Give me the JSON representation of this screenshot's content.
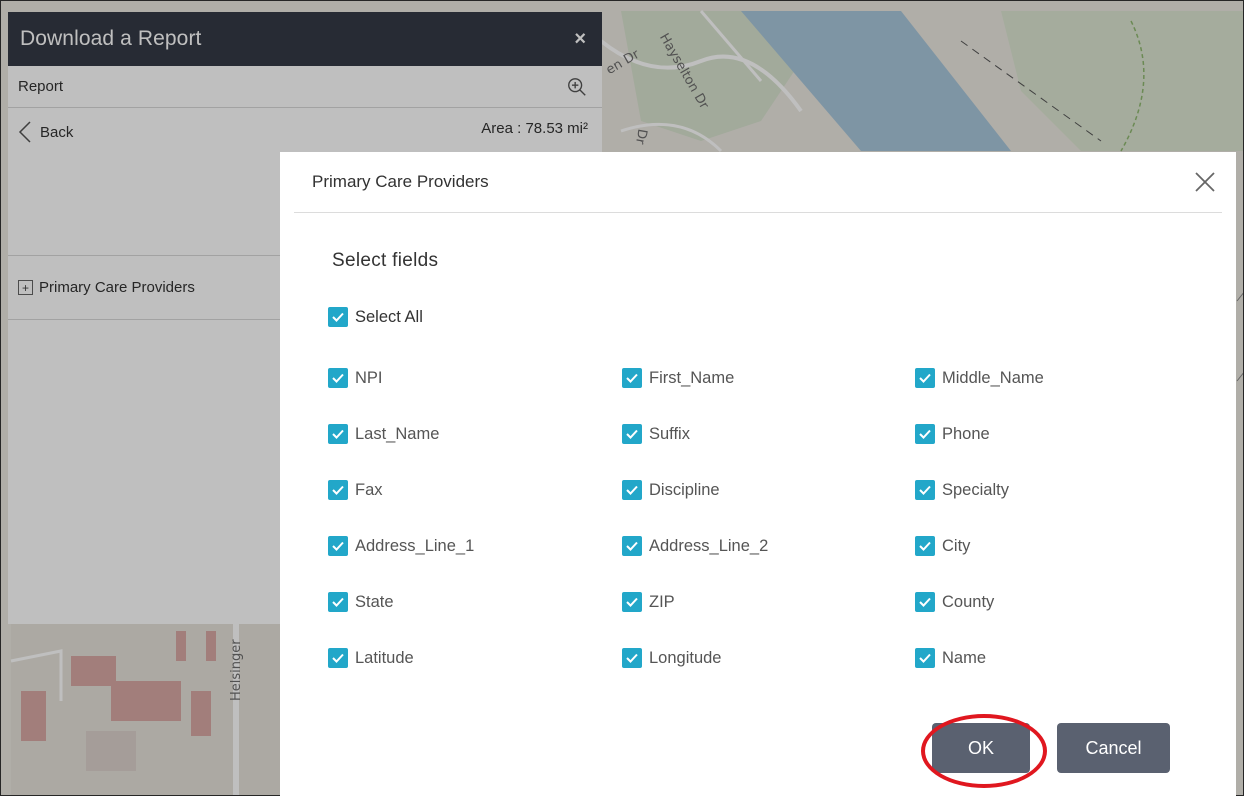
{
  "panel": {
    "title": "Download a Report",
    "close_label": "×",
    "report_label": "Report",
    "back_label": "Back",
    "area_label": "Area : 78.53 mi²",
    "layer_label": "Primary Care Providers",
    "expand_glyph": "+"
  },
  "map": {
    "street_labels": [
      "Hayselton Dr",
      "en Dr",
      "Dr",
      "Helsinger"
    ]
  },
  "dialog": {
    "title": "Primary Care Providers",
    "section_title": "Select fields",
    "select_all_label": "Select All",
    "fields": [
      {
        "label": "NPI",
        "checked": true
      },
      {
        "label": "First_Name",
        "checked": true
      },
      {
        "label": "Middle_Name",
        "checked": true
      },
      {
        "label": "Last_Name",
        "checked": true
      },
      {
        "label": "Suffix",
        "checked": true
      },
      {
        "label": "Phone",
        "checked": true
      },
      {
        "label": "Fax",
        "checked": true
      },
      {
        "label": "Discipline",
        "checked": true
      },
      {
        "label": "Specialty",
        "checked": true
      },
      {
        "label": "Address_Line_1",
        "checked": true
      },
      {
        "label": "Address_Line_2",
        "checked": true
      },
      {
        "label": "City",
        "checked": true
      },
      {
        "label": "State",
        "checked": true
      },
      {
        "label": "ZIP",
        "checked": true
      },
      {
        "label": "County",
        "checked": true
      },
      {
        "label": "Latitude",
        "checked": true
      },
      {
        "label": "Longitude",
        "checked": true
      },
      {
        "label": "Name",
        "checked": true
      }
    ],
    "ok_label": "OK",
    "cancel_label": "Cancel"
  },
  "colors": {
    "checkbox": "#22a7c9",
    "header": "#353a46",
    "button": "#5a6170",
    "highlight": "#e0171f"
  },
  "icons": [
    "zoom-in-icon",
    "close-icon",
    "chevron-left-icon",
    "checkmark-icon",
    "expand-plus-icon"
  ]
}
